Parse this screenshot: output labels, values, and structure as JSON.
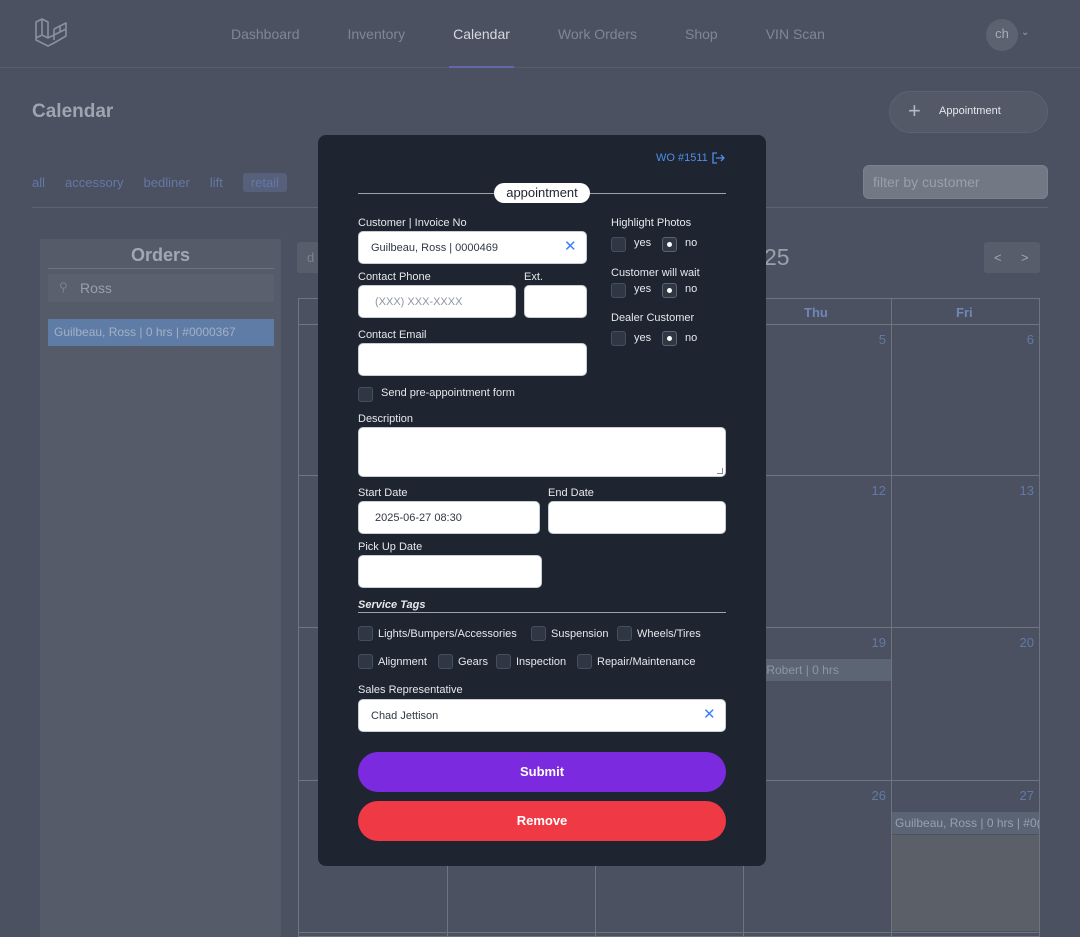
{
  "nav": {
    "links": [
      "Dashboard",
      "Inventory",
      "Calendar",
      "Work Orders",
      "Shop",
      "VIN Scan"
    ],
    "active": "Calendar",
    "avatar": "ch"
  },
  "page": {
    "title": "Calendar",
    "appointment_button": "Appointment",
    "filters": [
      "all",
      "accessory",
      "bedliner",
      "lift",
      "retail"
    ],
    "active_filter": "retail",
    "filter_placeholder": "filter by customer"
  },
  "orders": {
    "title": "Orders",
    "search_value": "Ross",
    "items": [
      "Guilbeau, Ross | 0 hrs | #0000367"
    ]
  },
  "calendar": {
    "view_label": "d",
    "month_partial": "25",
    "prev": "<",
    "next": ">",
    "weekdays": [
      "Thu",
      "Fri"
    ],
    "days": [
      "5",
      "6",
      "12",
      "13",
      "19",
      "20",
      "26",
      "27"
    ],
    "events": [
      "ler, Robert | 0 hrs",
      "Guilbeau, Ross | 0 hrs | #0("
    ]
  },
  "modal": {
    "wo_link": "WO #1511",
    "section_title": "appointment",
    "customer_label": "Customer | Invoice No",
    "customer_value": "Guilbeau, Ross | 0000469",
    "phone_label": "Contact Phone",
    "phone_placeholder": "(XXX) XXX-XXXX",
    "ext_label": "Ext.",
    "email_label": "Contact Email",
    "pre_form_label": "Send pre-appointment form",
    "description_label": "Description",
    "start_label": "Start Date",
    "start_value": "2025-06-27 08:30",
    "end_label": "End Date",
    "pickup_label": "Pick Up Date",
    "highlight_label": "Highlight Photos",
    "wait_label": "Customer will wait",
    "dealer_label": "Dealer Customer",
    "yes": "yes",
    "no": "no",
    "service_tags_label": "Service Tags",
    "service_tags": [
      "Lights/Bumpers/Accessories",
      "Suspension",
      "Wheels/Tires",
      "Alignment",
      "Gears",
      "Inspection",
      "Repair/Maintenance"
    ],
    "sales_rep_label": "Sales Representative",
    "sales_rep_value": "Chad Jettison",
    "submit": "Submit",
    "remove": "Remove"
  },
  "colors": {
    "modal_bg": "#1e2430",
    "submit": "#7c2ae0",
    "remove": "#ef3a46",
    "link": "#4f8fe8",
    "overlay_bg": "#4b5160"
  }
}
